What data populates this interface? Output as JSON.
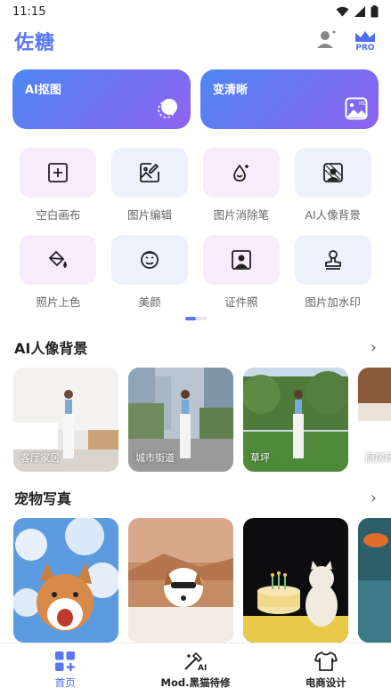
{
  "status_bar": {
    "time": "11:15"
  },
  "header": {
    "title": "佐糖",
    "pro_badge": "PRO"
  },
  "feature_cards": [
    {
      "label": "AI抠图",
      "icon": "cutout-icon"
    },
    {
      "label": "变清晰",
      "icon": "hd-photo-icon",
      "icon_text": "HD"
    }
  ],
  "tools": [
    {
      "label": "空白画布",
      "icon": "blank-canvas-icon"
    },
    {
      "label": "图片编辑",
      "icon": "image-edit-icon"
    },
    {
      "label": "图片消除笔",
      "icon": "eraser-pen-icon"
    },
    {
      "label": "AI人像背景",
      "icon": "portrait-background-icon"
    },
    {
      "label": "照片上色",
      "icon": "paint-bucket-icon"
    },
    {
      "label": "美颜",
      "icon": "beauty-face-icon"
    },
    {
      "label": "证件照",
      "icon": "id-photo-icon"
    },
    {
      "label": "图片加水印",
      "icon": "watermark-stamp-icon"
    }
  ],
  "sections": {
    "portrait_bg": {
      "title": "AI人像背景",
      "items": [
        {
          "caption": "客厅家居"
        },
        {
          "caption": "城市街道"
        },
        {
          "caption": "草坪"
        },
        {
          "caption": "厨房场"
        }
      ]
    },
    "pet_photo": {
      "title": "宠物写真",
      "items": [
        {
          "caption": ""
        },
        {
          "caption": ""
        },
        {
          "caption": ""
        },
        {
          "caption": ""
        }
      ]
    }
  },
  "bottom_nav": [
    {
      "label": "首页",
      "icon": "home-grid-icon",
      "active": true
    },
    {
      "label": "Mod.黑猫待修",
      "icon": "magic-wand-ai-icon",
      "active": false
    },
    {
      "label": "电商设计",
      "icon": "tshirt-icon",
      "active": false
    }
  ],
  "colors": {
    "accent": "#5b76f5",
    "card_gradient_start": "#4d86f4",
    "card_gradient_end": "#8f62f0"
  }
}
